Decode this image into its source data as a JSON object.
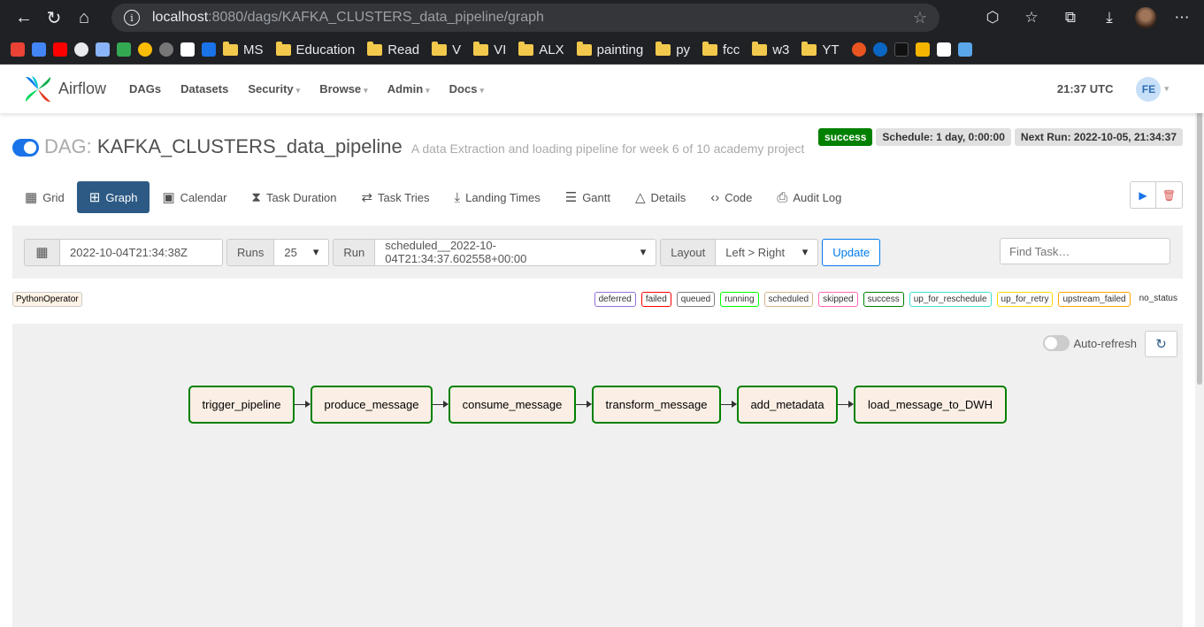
{
  "browser": {
    "url_host": "localhost",
    "url_path": ":8080/dags/KAFKA_CLUSTERS_data_pipeline/graph",
    "bookmark_folders": [
      "MS",
      "Education",
      "Read",
      "V",
      "VI",
      "ALX",
      "painting",
      "py",
      "fcc",
      "w3",
      "YT"
    ]
  },
  "navbar": {
    "brand": "Airflow",
    "menu": [
      "DAGs",
      "Datasets",
      "Security",
      "Browse",
      "Admin",
      "Docs"
    ],
    "time": "21:37 UTC",
    "user_initials": "FE"
  },
  "dag": {
    "prefix": "DAG:",
    "id": "KAFKA_CLUSTERS_data_pipeline",
    "description": "A data Extraction and loading pipeline for week 6 of 10 academy project",
    "state": "success",
    "schedule": "Schedule: 1 day, 0:00:00",
    "next_run": "Next Run: 2022-10-05, 21:34:37"
  },
  "tabs": [
    "Grid",
    "Graph",
    "Calendar",
    "Task Duration",
    "Task Tries",
    "Landing Times",
    "Gantt",
    "Details",
    "Code",
    "Audit Log"
  ],
  "controls": {
    "base_date": "2022-10-04T21:34:38Z",
    "runs_label": "Runs",
    "runs_value": "25",
    "run_label": "Run",
    "run_value": "scheduled__2022-10-04T21:34:37.602558+00:00",
    "layout_label": "Layout",
    "layout_value": "Left > Right",
    "update_label": "Update",
    "find_placeholder": "Find Task…"
  },
  "legend": {
    "operator": "PythonOperator",
    "states": [
      {
        "name": "deferred",
        "color": "#9370db"
      },
      {
        "name": "failed",
        "color": "#ff0000"
      },
      {
        "name": "queued",
        "color": "#808080"
      },
      {
        "name": "running",
        "color": "#00ff00"
      },
      {
        "name": "scheduled",
        "color": "#d2b48c"
      },
      {
        "name": "skipped",
        "color": "#ff69b4"
      },
      {
        "name": "success",
        "color": "#008000"
      },
      {
        "name": "up_for_reschedule",
        "color": "#40e0d0"
      },
      {
        "name": "up_for_retry",
        "color": "#ffd700"
      },
      {
        "name": "upstream_failed",
        "color": "#ffa500"
      },
      {
        "name": "no_status",
        "color": "#ffffff"
      }
    ]
  },
  "graph": {
    "autorefresh_label": "Auto-refresh",
    "tasks": [
      "trigger_pipeline",
      "produce_message",
      "consume_message",
      "transform_message",
      "add_metadata",
      "load_message_to_DWH"
    ],
    "task_state": "success",
    "success_color": "#008000"
  }
}
